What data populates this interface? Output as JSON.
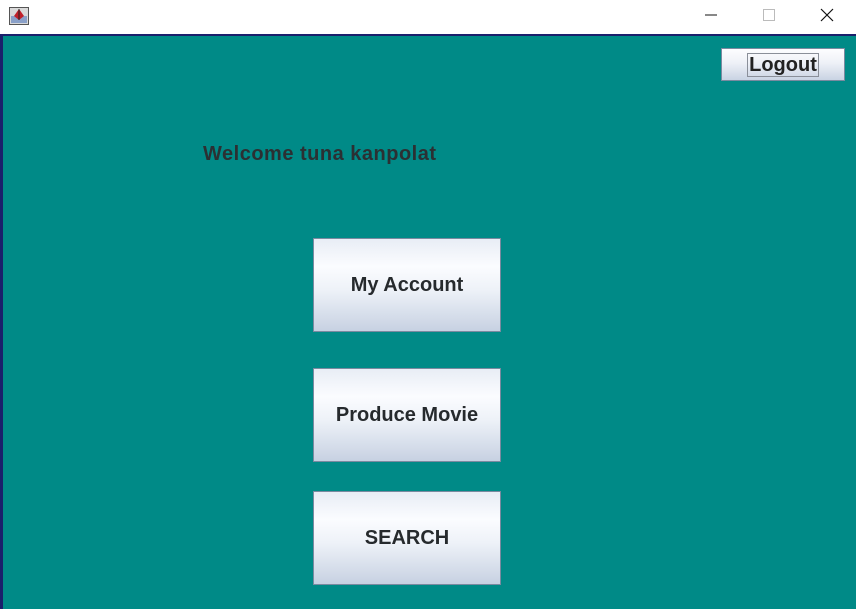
{
  "window": {
    "controls": {
      "minimize_icon": "minimize-icon",
      "maximize_icon": "maximize-icon",
      "close_icon": "close-icon"
    }
  },
  "colors": {
    "background": "#008a87",
    "border_accent": "#1a1f6b"
  },
  "header": {
    "logout_label": "Logout"
  },
  "main": {
    "welcome_text": "Welcome tuna kanpolat",
    "buttons": [
      {
        "label": "My Account"
      },
      {
        "label": "Produce Movie"
      },
      {
        "label": "SEARCH"
      }
    ]
  }
}
